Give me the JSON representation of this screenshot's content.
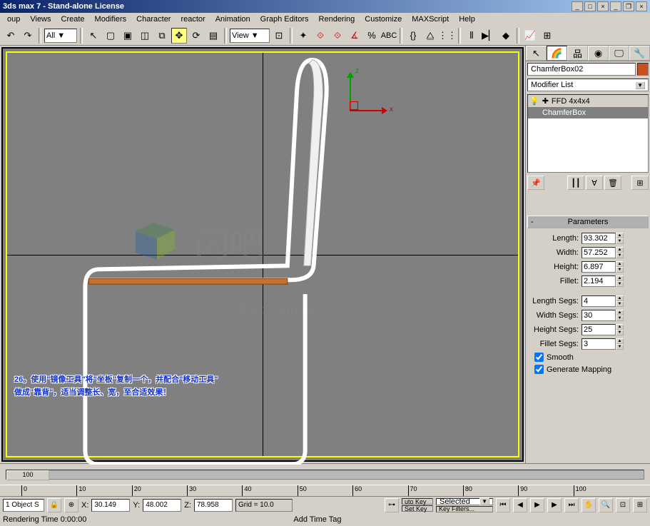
{
  "title": "3ds max 7 - Stand-alone License",
  "menus": [
    "oup",
    "Views",
    "Create",
    "Modifiers",
    "Character",
    "reactor",
    "Animation",
    "Graph Editors",
    "Rendering",
    "Customize",
    "MAXScript",
    "Help"
  ],
  "toolbar": {
    "selection_filter": "All",
    "view_combo": "View"
  },
  "viewport": {
    "axis_x": "x",
    "axis_z": "z",
    "annotation_line1": "26。使用\"镜像工具\"将\"坐板\"复制一个，并配合\"移动工具\"",
    "annotation_line2": "做成\"靠背\"，适当调整长、宽，至合适效果！",
    "watermark_text": "闪吧",
    "watermark_sub": "撰写：nebula"
  },
  "panel": {
    "object_name": "ChamferBox02",
    "modifier_list_label": "Modifier List",
    "stack": {
      "item1": "FFD 4x4x4",
      "item2": "ChamferBox"
    },
    "rollout_title": "Parameters",
    "params": {
      "length_label": "Length:",
      "length": "93.302",
      "width_label": "Width:",
      "width": "57.252",
      "height_label": "Height:",
      "height": "6.897",
      "fillet_label": "Fillet:",
      "fillet": "2.194",
      "length_segs_label": "Length Segs:",
      "length_segs": "4",
      "width_segs_label": "Width Segs:",
      "width_segs": "30",
      "height_segs_label": "Height Segs:",
      "height_segs": "25",
      "fillet_segs_label": "Fillet Segs:",
      "fillet_segs": "3",
      "smooth_label": "Smooth",
      "gen_mapping_label": "Generate Mapping"
    }
  },
  "timeline": {
    "thumb": "100",
    "ticks": [
      "0",
      "10",
      "20",
      "30",
      "40",
      "50",
      "60",
      "70",
      "80",
      "90",
      "100"
    ]
  },
  "status": {
    "sel": "1 Object S",
    "x_label": "X:",
    "x": "30.149",
    "y_label": "Y:",
    "y": "48.002",
    "z_label": "Z:",
    "z": "78.958",
    "grid": "Grid = 10.0",
    "auto_key": "uto Key",
    "selected": "Selected",
    "set_key": "Set Key",
    "key_filters": "Key Filters..."
  },
  "prompt": {
    "rendering": "Rendering Time 0:00:00",
    "add_tag": "Add Time Tag"
  }
}
